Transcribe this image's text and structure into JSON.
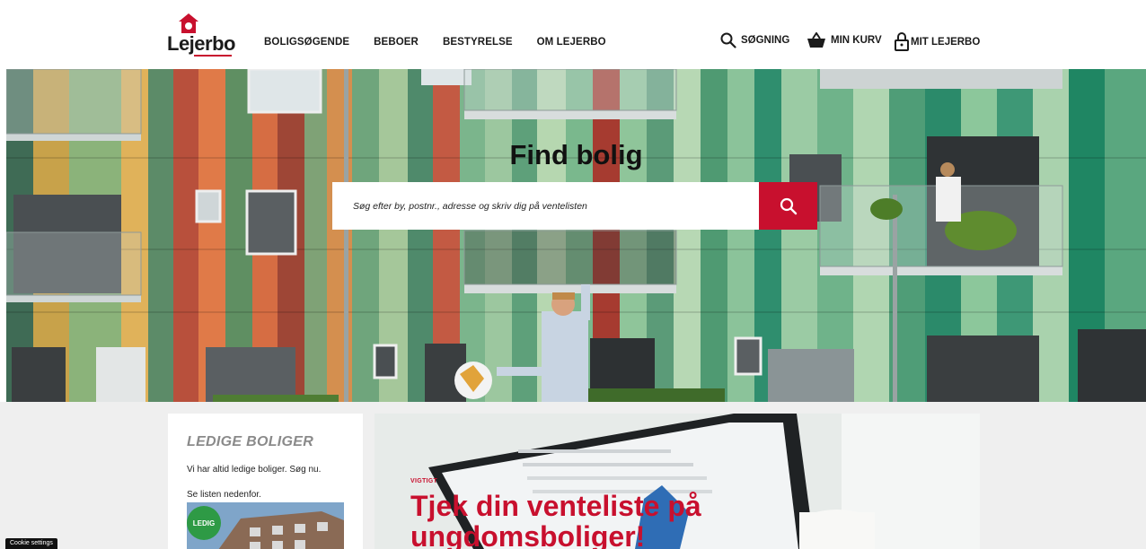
{
  "brand": {
    "name": "Lejerbo"
  },
  "nav": {
    "items": [
      "BOLIGSØGENDE",
      "BEBOER",
      "BESTYRELSE",
      "OM LEJERBO"
    ]
  },
  "utility": {
    "search": "SØGNING",
    "cart": "MIN KURV",
    "account": "MIT LEJERBO"
  },
  "hero": {
    "title": "Find bolig",
    "search_placeholder": "Søg efter by, postnr., adresse og skriv dig på ventelisten"
  },
  "card": {
    "title": "LEDIGE BOLIGER",
    "line1": "Vi har altid ledige boliger. Søg nu.",
    "line2": "Se listen nedenfor.",
    "badge": "LEDIG"
  },
  "promo": {
    "label": "VIGTIGT",
    "title": "Tjek din venteliste på ungdomsboliger!"
  },
  "cookie": {
    "label": "Cookie settings"
  },
  "colors": {
    "accent": "#c8102e",
    "text": "#1b1b1b",
    "page_bg": "#efefef"
  }
}
